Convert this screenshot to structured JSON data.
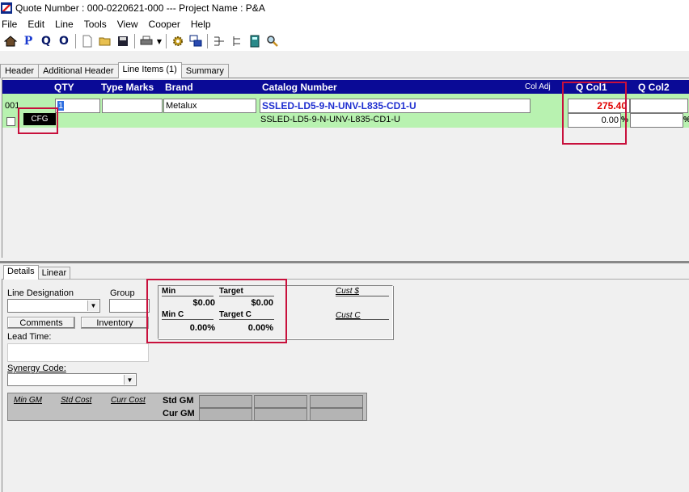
{
  "window": {
    "title": "Quote Number : 000-0220621-000 --- Project Name : P&A"
  },
  "menu": [
    "File",
    "Edit",
    "Line",
    "Tools",
    "View",
    "Cooper",
    "Help"
  ],
  "toolbar": {
    "p_label": "P",
    "q_label": "Q",
    "o_label": "O"
  },
  "tabs_top": [
    "Header",
    "Additional Header",
    "Line Items (1)",
    "Summary"
  ],
  "grid": {
    "headers": {
      "qty": "QTY",
      "type_marks": "Type Marks",
      "brand": "Brand",
      "catalog_number": "Catalog Number",
      "col_adj": "Col Adj",
      "q_col1": "Q Col1",
      "q_col2": "Q Col2"
    },
    "row": {
      "line_no": "001",
      "qty": "1",
      "type_marks": "",
      "brand": "Metalux",
      "catalog_number": "SSLED-LD5-9-N-UNV-L835-CD1-U",
      "catalog_sub": "SSLED-LD5-9-N-UNV-L835-CD1-U",
      "cfg_label": "CFG",
      "q_col1_price": "275.40",
      "q_col1_pct": "0.00",
      "pct_sign": "%",
      "q_col2_price": "",
      "q_col2_pct": ""
    }
  },
  "tabs_bottom": [
    "Details",
    "Linear"
  ],
  "details": {
    "line_designation_label": "Line Designation",
    "group_label": "Group",
    "comments_button": "Comments",
    "inventory_button": "Inventory",
    "lead_time_label": "Lead Time:",
    "synergy_code_label": "Synergy Code:"
  },
  "pricing": {
    "min_label": "Min",
    "target_label": "Target",
    "min_value": "$0.00",
    "target_value": "$0.00",
    "min_c_label": "Min C",
    "target_c_label": "Target C",
    "min_c_value": "0.00%",
    "target_c_value": "0.00%",
    "cust_dollar_label": "Cust $",
    "cust_c_label": "Cust C"
  },
  "gm": {
    "min_gm_label": "Min GM",
    "std_cost_label": "Std Cost",
    "curr_cost_label": "Curr Cost",
    "std_gm_label": "Std GM",
    "cur_gm_label": "Cur GM"
  },
  "colors": {
    "header_bg": "#0a0a96",
    "row_bg": "#b8f2b0",
    "catalog_blue": "#1f2fd0",
    "price_red": "#e00000",
    "highlight": "#c8103c"
  }
}
